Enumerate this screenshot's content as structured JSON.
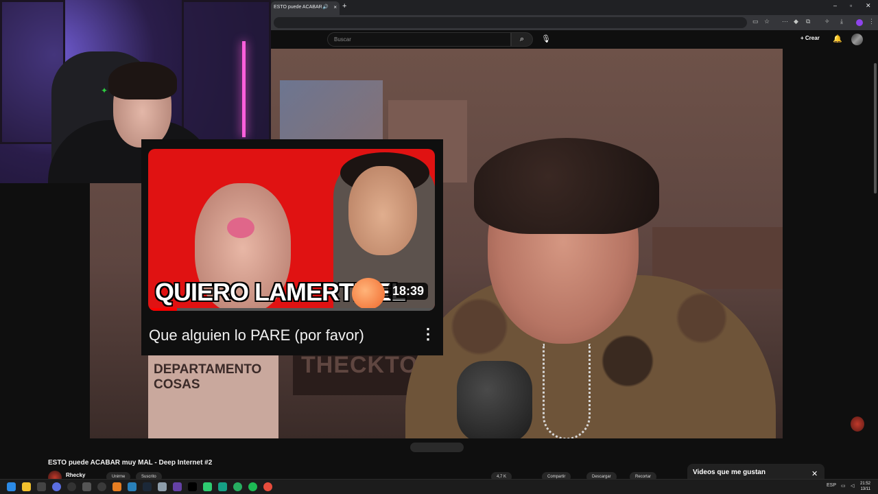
{
  "browser": {
    "tab_title": "ESTO puede ACABAR muy",
    "audio_icon": "speaker-icon",
    "close_icon": "×",
    "new_tab": "+",
    "win_minimize": "–",
    "win_maximize": "▫",
    "win_close": "✕"
  },
  "youtube": {
    "search_placeholder": "Buscar",
    "create_label": "Crear",
    "create_plus": "+"
  },
  "thumbnail_card": {
    "caption": "QUIERO LAMERTE EL",
    "duration": "18:39",
    "title": "Que alguien lo PARE (por favor)",
    "menu": "⋮",
    "progress": 0.1
  },
  "video_signs": {
    "department": "DEPARTAMENTO\nCOSAS",
    "logo": "THECKTOM"
  },
  "watch": {
    "title": "ESTO puede ACABAR muy MAL - Deep Internet #2",
    "channel": "Rhecky",
    "join_label": "Unirme",
    "subscribe_label": "Suscrito",
    "likes": "4,7 K",
    "share_label": "Compartir",
    "download_label": "Descargar",
    "clip_label": "Recortar"
  },
  "liked_panel": {
    "title": "Videos que me gustan",
    "close": "✕"
  },
  "taskbar": {
    "lang": "ESP",
    "time": "21:52",
    "date": "13/11"
  },
  "colors": {
    "youtube_bg": "#0f0f0f",
    "accent_red": "#ff0000",
    "thumbnail_red": "#e01212"
  }
}
